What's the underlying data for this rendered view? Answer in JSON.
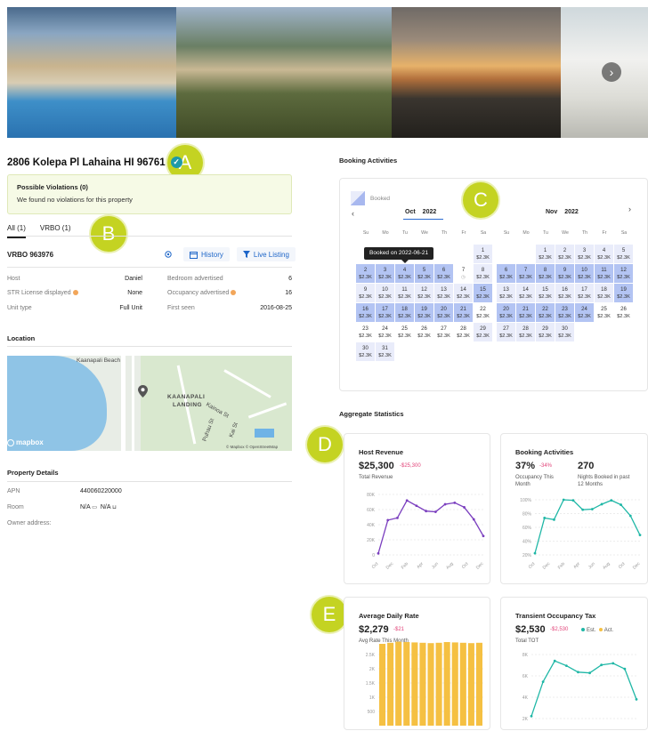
{
  "gallery": {
    "next_icon": "›"
  },
  "callouts": {
    "a": "A",
    "b": "B",
    "c": "C",
    "d": "D",
    "e": "E"
  },
  "property": {
    "address": "2806 Kolepa Pl Lahaina HI 96761",
    "verified_icon": "✓",
    "violations_title": "Possible Violations (0)",
    "violations_text": "We found no violations for this property"
  },
  "tabs": [
    {
      "label": "All (1)"
    },
    {
      "label": "VRBO (1)"
    }
  ],
  "listing": {
    "id": "VRBO 963976",
    "history_label": "History",
    "live_label": "Live Listing",
    "host_k": "Host",
    "host_v": "Daniel",
    "bed_k": "Bedroom advertised",
    "bed_v": "6",
    "str_k": "STR License displayed",
    "str_v": "None",
    "occ_k": "Occupancy advertised",
    "occ_v": "16",
    "unit_k": "Unit type",
    "unit_v": "Full Unit",
    "seen_k": "First seen",
    "seen_v": "2016-08-25"
  },
  "location": {
    "title": "Location",
    "beach": "Kaanapali Beach",
    "landing1": "KAANAPALI",
    "landing2": "LANDING",
    "street1": "Kainoa St",
    "street2": "Kai St",
    "street3": "Puhau St",
    "mapbox": "mapbox",
    "copyright": "© Mapbox © OpenStreetMap"
  },
  "details": {
    "title": "Property Details",
    "apn_k": "APN",
    "apn_v": "440060220000",
    "room_k": "Room",
    "room_v1": "N/A",
    "room_v2": "N/A",
    "owner_k": "Owner address:"
  },
  "booking": {
    "title": "Booking Activities",
    "legend": "Booked",
    "prev": "‹",
    "next": "›",
    "tooltip": "Booked on 2022-06-21",
    "weekdays": [
      "Su",
      "Mo",
      "Tu",
      "We",
      "Th",
      "Fr",
      "Sa"
    ],
    "months": [
      {
        "name": "Oct",
        "year": "2022"
      },
      {
        "name": "Nov",
        "year": "2022"
      }
    ]
  },
  "agg": {
    "title": "Aggregate Statistics"
  },
  "cards": {
    "rev": {
      "title": "Host Revenue",
      "big": "$25,300",
      "delta": "-$25,300",
      "sub": "Total Revenue"
    },
    "act": {
      "title": "Booking Activities",
      "big1": "37%",
      "delta": "-34%",
      "sub1a": "Occupancy This",
      "sub1b": "Month",
      "big2": "270",
      "sub2a": "Nights Booked in past",
      "sub2b": "12 Months"
    },
    "adr": {
      "title": "Average Daily Rate",
      "big": "$2,279",
      "delta": "-$21",
      "sub": "Avg Rate This Month"
    },
    "tot": {
      "title": "Transient Occupancy Tax",
      "big": "$2,530",
      "delta": "-$2,530",
      "est": "Est.",
      "act": "Act.",
      "sub": "Total TOT"
    }
  },
  "colors": {
    "purple": "#7b3fbf",
    "teal": "#1fb7a6",
    "bar": "#f5c042",
    "booked": "#b3c4f3",
    "accent": "#c4d322"
  },
  "chart_data": [
    {
      "type": "line",
      "title": "Host Revenue",
      "x": [
        "Oct",
        "Dec",
        "Feb",
        "Apr",
        "Jun",
        "Aug",
        "Oct",
        "Dec"
      ],
      "y_ticks": [
        "80K",
        "60K",
        "40K",
        "20K",
        "0"
      ],
      "ylim": [
        0,
        80000
      ],
      "series": [
        {
          "values": [
            2000,
            46000,
            49000,
            72000,
            65000,
            58000,
            57000,
            67000,
            69000,
            63000,
            47000,
            25000
          ]
        }
      ]
    },
    {
      "type": "line",
      "title": "Booking Activities",
      "x": [
        "Oct",
        "Dec",
        "Feb",
        "Apr",
        "Jun",
        "Aug",
        "Oct",
        "Dec"
      ],
      "y_ticks": [
        "100%",
        "80%",
        "60%",
        "40%",
        "20%"
      ],
      "ylim": [
        0,
        100
      ],
      "series": [
        {
          "values": [
            3,
            67,
            64,
            100,
            99,
            82,
            83,
            92,
            99,
            91,
            71,
            36
          ]
        }
      ]
    },
    {
      "type": "bar",
      "title": "Average Daily Rate",
      "y_ticks": [
        "2.5K",
        "2K",
        "1.5K",
        "1K",
        "500"
      ],
      "ylim": [
        0,
        2500
      ],
      "series": [
        {
          "values": [
            2300,
            2330,
            2360,
            2350,
            2340,
            2330,
            2320,
            2330,
            2350,
            2340,
            2330,
            2320,
            2330
          ]
        }
      ]
    },
    {
      "type": "line",
      "title": "Transient Occupancy Tax",
      "y_ticks": [
        "8K",
        "6K",
        "4K",
        "2K"
      ],
      "ylim": [
        0,
        8000
      ],
      "series": [
        {
          "values": [
            300,
            4600,
            7200,
            6600,
            5800,
            5700,
            6700,
            6900,
            6200,
            2400
          ]
        }
      ]
    }
  ]
}
